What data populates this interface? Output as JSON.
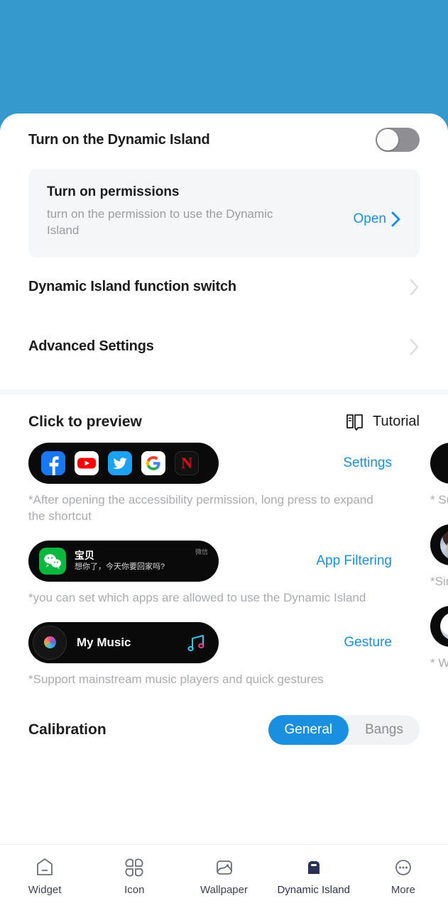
{
  "theme": {
    "header_blue": "#3699CE",
    "accent_blue": "#1A8FE0",
    "card_gray": "#F5F6F8",
    "muted_text": "#9B9DA1",
    "nav_active": "#2B3055"
  },
  "settings": {
    "main_toggle": {
      "label": "Turn on the Dynamic Island",
      "state": "off"
    },
    "permission_card": {
      "title": "Turn on permissions",
      "description": "turn on the permission to use the Dynamic Island",
      "action_label": "Open"
    },
    "rows": [
      {
        "label": "Dynamic Island function switch"
      },
      {
        "label": "Advanced Settings"
      }
    ]
  },
  "preview": {
    "title": "Click to preview",
    "tutorial_label": "Tutorial",
    "items": [
      {
        "kind": "shortcuts",
        "action_label": "Settings",
        "note": "*After opening the accessibility permission, long press to expand the shortcut",
        "apps": [
          "facebook",
          "youtube",
          "twitter",
          "google",
          "netflix"
        ]
      },
      {
        "kind": "notification",
        "action_label": "App Filtering",
        "note": "*you can set which apps are allowed to use the Dynamic Island",
        "sender": "宝贝",
        "message": "想你了，今天你要回家吗?",
        "source": "微信"
      },
      {
        "kind": "music",
        "action_label": "Gesture",
        "note": "*Support mainstream music players and quick gestures",
        "track": "My Music"
      }
    ],
    "next_page_items": [
      {
        "note": "* Su"
      },
      {
        "note": "*Sin"
      },
      {
        "note": "* Wi\nBlue"
      }
    ]
  },
  "calibration": {
    "title": "Calibration",
    "options": [
      "General",
      "Bangs"
    ],
    "selected": "General"
  },
  "bottom_nav": {
    "items": [
      {
        "label": "Widget",
        "icon": "widget-icon",
        "active": false
      },
      {
        "label": "Icon",
        "icon": "grid-icon",
        "active": false
      },
      {
        "label": "Wallpaper",
        "icon": "image-icon",
        "active": false
      },
      {
        "label": "Dynamic Island",
        "icon": "dynamic-island-icon",
        "active": true
      },
      {
        "label": "More",
        "icon": "more-dots-icon",
        "active": false
      }
    ]
  }
}
